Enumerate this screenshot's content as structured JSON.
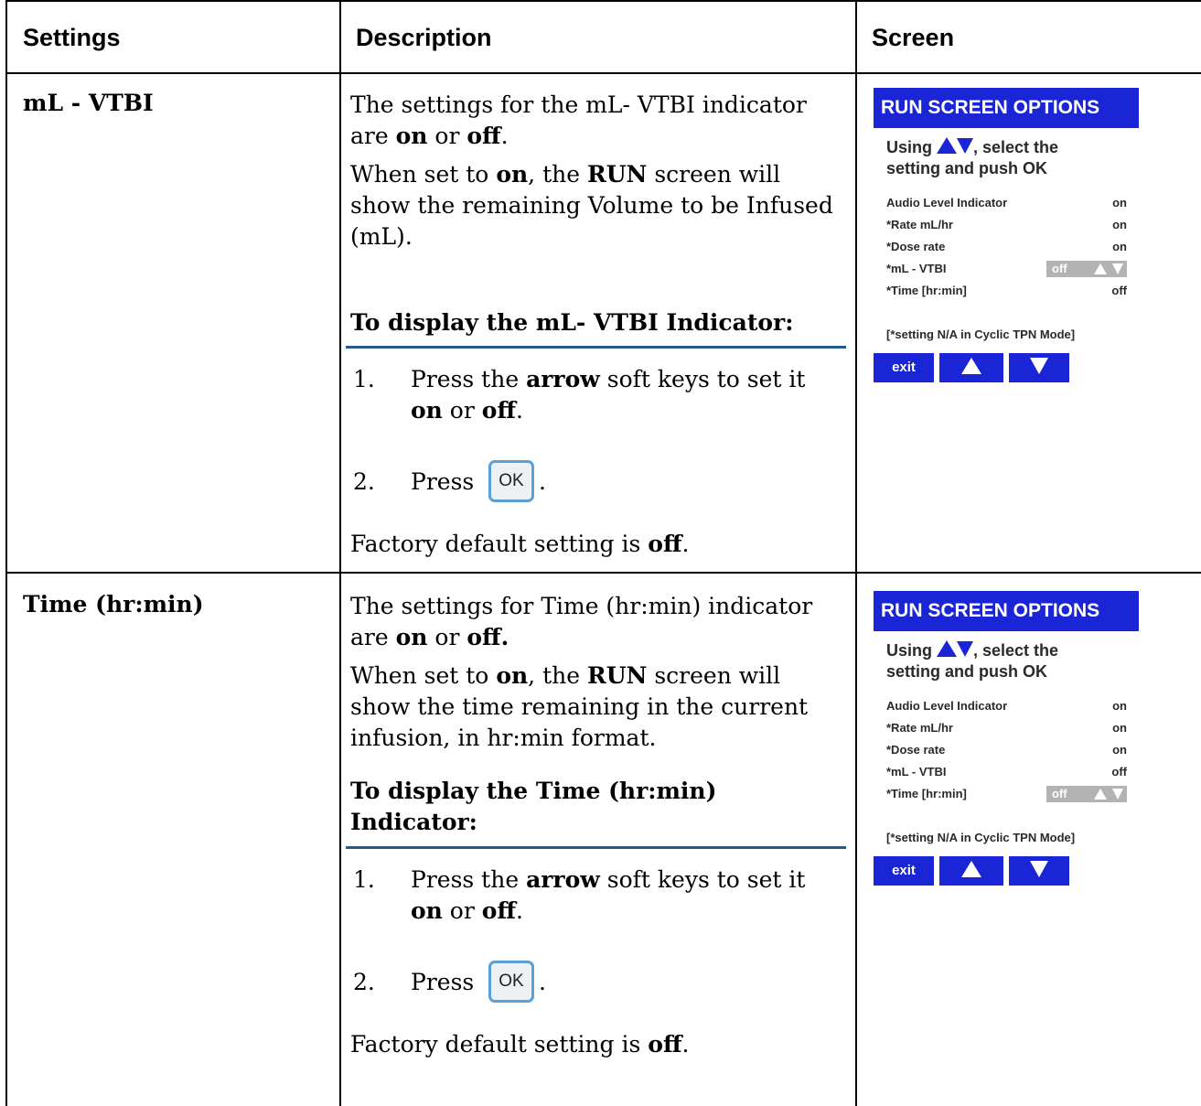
{
  "headers": {
    "settings": "Settings",
    "description": "Description",
    "screen": "Screen"
  },
  "rows": [
    {
      "setting": "mL - VTBI",
      "desc1": {
        "a": "The settings for the mL- VTBI indicator are ",
        "b": "on",
        "c": " or ",
        "d": "off",
        "e": "."
      },
      "desc2": {
        "a": "When set to ",
        "b": "on",
        "c": ", the ",
        "d": "RUN",
        "e": " screen will show the remaining Volume to be Infused (mL)."
      },
      "procedure": "To display the mL- VTBI Indicator:",
      "step1": {
        "num": "1.",
        "a": "Press the ",
        "b": "arrow",
        "c": " soft keys to set it ",
        "d": "on",
        "e": " or ",
        "f": "off",
        "g": "."
      },
      "step2": {
        "num": "2.",
        "a": "Press",
        "key": "OK",
        "end": "."
      },
      "default": {
        "a": "Factory default setting is ",
        "b": "off",
        "c": "."
      },
      "screen": {
        "title": "RUN SCREEN OPTIONS",
        "instr_a": "Using ",
        "instr_b": ", select the",
        "instr_c": "setting and push OK",
        "items": [
          {
            "label": "Audio Level Indicator",
            "value": "on"
          },
          {
            "label": "*Rate mL/hr",
            "value": "on"
          },
          {
            "label": "*Dose rate",
            "value": "on"
          },
          {
            "label": "*mL - VTBI",
            "value": "off"
          },
          {
            "label": "*Time [hr:min]",
            "value": "off"
          }
        ],
        "note": "[*setting N/A in Cyclic TPN Mode]",
        "exit": "exit"
      }
    },
    {
      "setting": "Time (hr:min)",
      "desc1": {
        "a": "The settings for Time (hr:min) indicator are ",
        "b": "on",
        "c": " or ",
        "d": "off."
      },
      "desc2": {
        "a": "When set to ",
        "b": "on",
        "c": ", the ",
        "d": "RUN",
        "e": " screen will show the time remaining in the current infusion, in hr:min format."
      },
      "procedure": "To display the Time (hr:min) Indicator:",
      "step1": {
        "num": "1.",
        "a": "Press the ",
        "b": "arrow",
        "c": " soft keys to set it ",
        "d": "on",
        "e": " or ",
        "f": "off",
        "g": "."
      },
      "step2": {
        "num": "2.",
        "a": "Press",
        "key": "OK",
        "end": "."
      },
      "default": {
        "a": "Factory default setting is ",
        "b": "off",
        "c": "."
      },
      "screen": {
        "title": "RUN SCREEN OPTIONS",
        "instr_a": "Using ",
        "instr_b": ", select the",
        "instr_c": "setting and push OK",
        "items": [
          {
            "label": "Audio Level Indicator",
            "value": "on"
          },
          {
            "label": "*Rate mL/hr",
            "value": "on"
          },
          {
            "label": "*Dose rate",
            "value": "on"
          },
          {
            "label": "*mL - VTBI",
            "value": "off"
          },
          {
            "label": "*Time [hr:min]",
            "value": "off"
          }
        ],
        "note": "[*setting N/A in Cyclic TPN Mode]",
        "exit": "exit"
      }
    }
  ]
}
